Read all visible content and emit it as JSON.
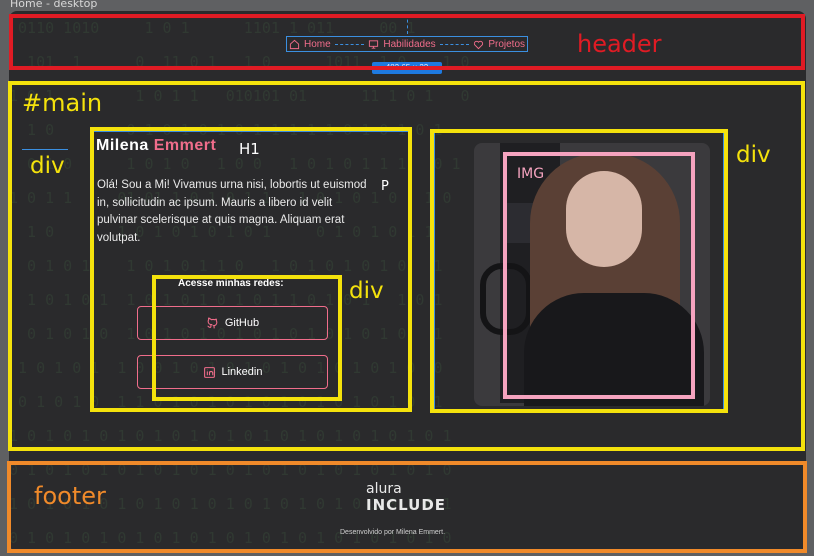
{
  "frame_title": "Home - desktop",
  "nav": {
    "items": [
      {
        "label": "Home",
        "icon": "home-icon"
      },
      {
        "label": "Habilidades",
        "icon": "monitor-icon"
      },
      {
        "label": "Projetos",
        "icon": "heart-icon"
      }
    ],
    "size_badge": "482.65 × 22"
  },
  "annotations": {
    "header": "header",
    "main": "#main",
    "div": "div",
    "h1": "H1",
    "p": "P",
    "img": "IMG",
    "footer": "footer",
    "colors": {
      "header": "#e01b24",
      "main": "#f4e20c",
      "footer": "#f08a2a",
      "img": "#f5a3bf"
    }
  },
  "hero": {
    "name_first": "Milena",
    "name_last": "Emmert",
    "intro": "Olá! Sou a Mi! Vivamus urna nisi, lobortis ut euismod in, sollicitudin ac ipsum. Mauris a libero id velit pulvinar scelerisque at quis magna. Aliquam erat volutpat.",
    "social_title": "Acesse minhas redes:",
    "github_label": "GitHub",
    "linkedin_label": "Linkedin"
  },
  "footer": {
    "logo_line1": "alura",
    "logo_line2": "INCLUDE",
    "credit": "Desenvolvido por Milena Emmert."
  },
  "colors": {
    "accent": "#f06d8b",
    "background": "#2a2a2c",
    "guide_blue": "#3b8fe0"
  }
}
